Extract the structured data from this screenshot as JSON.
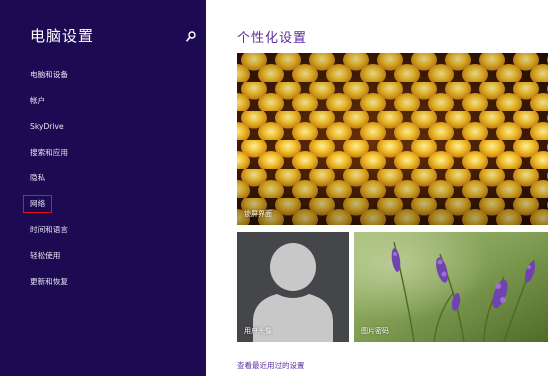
{
  "sidebar": {
    "title": "电脑设置",
    "items": [
      {
        "label": "电脑和设备"
      },
      {
        "label": "帐户"
      },
      {
        "label": "SkyDrive"
      },
      {
        "label": "搜索和应用"
      },
      {
        "label": "隐私"
      },
      {
        "label": "网络",
        "selected": true
      },
      {
        "label": "时间和语言"
      },
      {
        "label": "轻松使用"
      },
      {
        "label": "更新和恢复"
      }
    ],
    "selection_outline_color": "#e5121b"
  },
  "main": {
    "title": "个性化设置",
    "tiles": {
      "lock_screen": {
        "label": "锁屏界面"
      },
      "user_avatar": {
        "label": "用户头像"
      },
      "picture_password": {
        "label": "图片密码"
      }
    },
    "recent_link": "查看最近用过的设置"
  },
  "icons": {
    "search": "search-icon",
    "user_silhouette": "user-silhouette-icon"
  },
  "colors": {
    "sidebar_bg": "#1c0a52",
    "accent": "#5b2d9e",
    "main_bg": "#ffffff"
  }
}
